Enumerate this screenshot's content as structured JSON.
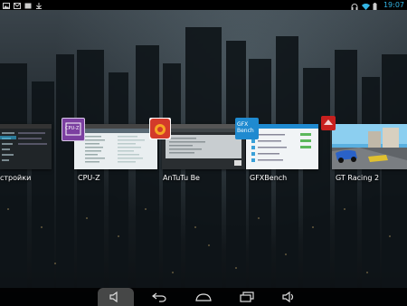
{
  "status_bar": {
    "clock": "19:07",
    "left_icons": [
      "image-icon",
      "mail-icon",
      "screenshot-icon",
      "download-icon"
    ],
    "right_icons": [
      "headset-icon",
      "wifi-icon",
      "battery-icon"
    ]
  },
  "recents": {
    "cards": [
      {
        "label": "стройки",
        "icon": "settings-icon"
      },
      {
        "label": "CPU-Z",
        "icon": "cpuz-icon"
      },
      {
        "label": "AnTuTu Be",
        "icon": "antutu-icon"
      },
      {
        "label": "GFXBench",
        "icon": "gfxbench-icon"
      },
      {
        "label": "GT Racing 2",
        "icon": "gtracing-icon"
      }
    ],
    "icons_text": {
      "cpuz": "CPU-Z",
      "gfx": "GFX Bench"
    }
  },
  "nav_bar": {
    "buttons": [
      "volume-down-icon",
      "back-icon",
      "home-icon",
      "recents-icon",
      "volume-up-icon"
    ],
    "pressed": "volume-down-icon"
  },
  "colors": {
    "accent": "#33b5e5",
    "cpuz": "#7b3fa0",
    "antutu": "#d33a2a",
    "gfx": "#1f8ad0",
    "gtracing": "#c8201e"
  }
}
